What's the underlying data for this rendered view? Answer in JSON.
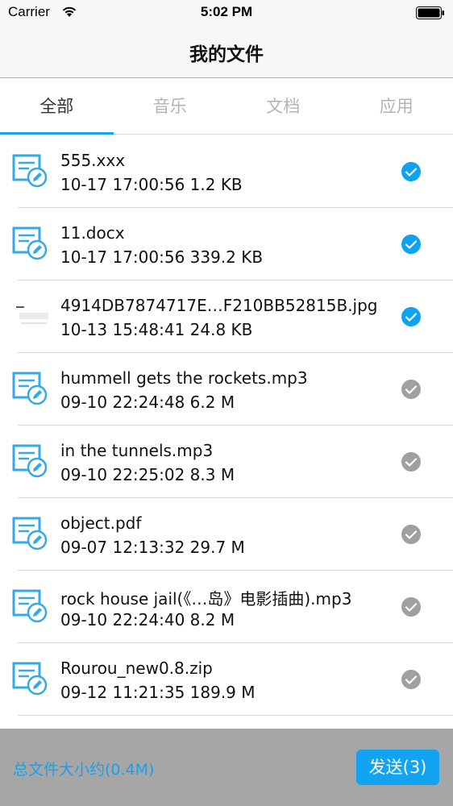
{
  "status_bar": {
    "carrier": "Carrier",
    "time": "5:02 PM"
  },
  "nav": {
    "title": "我的文件"
  },
  "tabs": [
    {
      "label": "全部",
      "active": true
    },
    {
      "label": "音乐",
      "active": false
    },
    {
      "label": "文档",
      "active": false
    },
    {
      "label": "应用",
      "active": false
    }
  ],
  "files": [
    {
      "name": "555.xxx",
      "meta": "10-17 17:00:56   1.2 KB",
      "icon": "document-edit-icon",
      "selected": true
    },
    {
      "name": "11.docx",
      "meta": "10-17 17:00:56   339.2 KB",
      "icon": "document-edit-icon",
      "selected": true
    },
    {
      "name": "4914DB7874717E…F210BB52815B.jpg",
      "meta": "10-13 15:48:41   24.8 KB",
      "icon": "image-thumbnail",
      "selected": true
    },
    {
      "name": "hummell gets the rockets.mp3",
      "meta": "09-10 22:24:48   6.2 M",
      "icon": "document-edit-icon",
      "selected": false
    },
    {
      "name": "in the tunnels.mp3",
      "meta": "09-10 22:25:02   8.3 M",
      "icon": "document-edit-icon",
      "selected": false
    },
    {
      "name": "object.pdf",
      "meta": "09-07 12:13:32   29.7 M",
      "icon": "document-edit-icon",
      "selected": false
    },
    {
      "name": "rock house jail(《…岛》电影插曲).mp3",
      "meta": "09-10 22:24:40   8.2 M",
      "icon": "document-edit-icon",
      "selected": false
    },
    {
      "name": "Rourou_new0.8.zip",
      "meta": "09-12 11:21:35   189.9 M",
      "icon": "document-edit-icon",
      "selected": false
    }
  ],
  "footer": {
    "total_size": "总文件大小约(0.4M)",
    "send_label": "发送(3)"
  },
  "colors": {
    "accent": "#19a6ee",
    "selected_check": "#0ea2f0",
    "unselected_check": "#a0a0a0",
    "bottom_bar": "#a6a6a6"
  }
}
